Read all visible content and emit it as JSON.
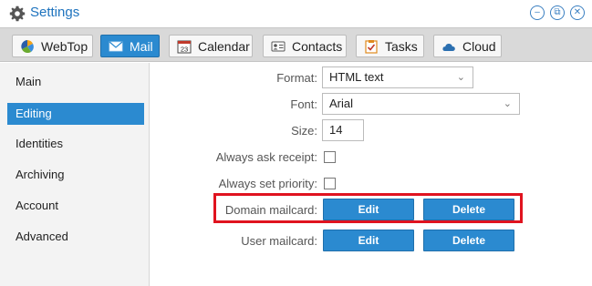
{
  "window": {
    "title": "Settings",
    "icon": "gear-icon"
  },
  "tabs": [
    {
      "label": "WebTop",
      "icon": "webtop-icon"
    },
    {
      "label": "Mail",
      "icon": "mail-icon",
      "active": true
    },
    {
      "label": "Calendar",
      "icon": "calendar-icon"
    },
    {
      "label": "Contacts",
      "icon": "contacts-icon"
    },
    {
      "label": "Tasks",
      "icon": "tasks-icon"
    },
    {
      "label": "Cloud",
      "icon": "cloud-icon"
    }
  ],
  "sidebar": {
    "items": [
      {
        "label": "Main"
      },
      {
        "label": "Editing",
        "selected": true
      },
      {
        "label": "Identities"
      },
      {
        "label": "Archiving"
      },
      {
        "label": "Account"
      },
      {
        "label": "Advanced"
      }
    ]
  },
  "form": {
    "format_label": "Format:",
    "format_value": "HTML text",
    "font_label": "Font:",
    "font_value": "Arial",
    "size_label": "Size:",
    "size_value": "14",
    "ask_receipt_label": "Always ask receipt:",
    "ask_receipt_checked": false,
    "set_priority_label": "Always set priority:",
    "set_priority_checked": false,
    "domain_mailcard_label": "Domain mailcard:",
    "user_mailcard_label": "User mailcard:",
    "edit_label": "Edit",
    "delete_label": "Delete"
  },
  "colors": {
    "accent": "#2b8ad0",
    "highlight": "#e0131f",
    "title": "#1e73be"
  }
}
